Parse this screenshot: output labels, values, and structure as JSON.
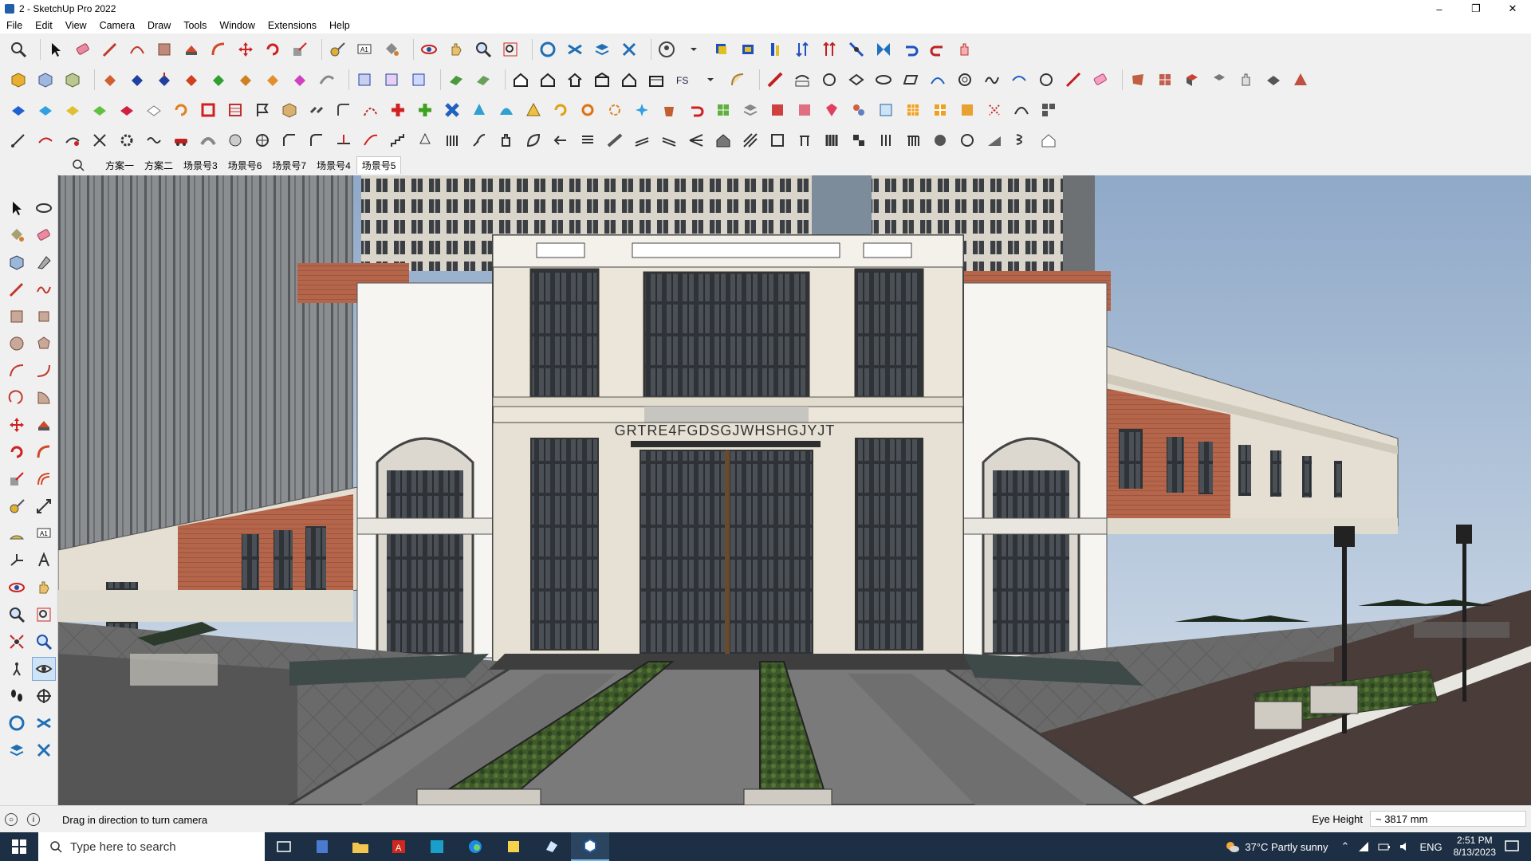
{
  "window": {
    "title": "2 - SketchUp Pro 2022",
    "controls": [
      "–",
      "❐",
      "✕"
    ]
  },
  "menu": [
    "File",
    "Edit",
    "View",
    "Camera",
    "Draw",
    "Tools",
    "Window",
    "Extensions",
    "Help"
  ],
  "scenes": {
    "tabs": [
      "方案一",
      "方案二",
      "场景号3",
      "场景号6",
      "场景号7",
      "场景号4",
      "场景号5"
    ],
    "active_index": 6
  },
  "viewport": {
    "signage": "GRTRE4FGDSGJWHSHGJYJT"
  },
  "status": {
    "hint": "Drag in direction to turn camera",
    "eye_height_label": "Eye Height",
    "eye_height_value": "~ 3817 mm"
  },
  "taskbar": {
    "search_placeholder": "Type here to search",
    "weather": "37°C  Partly sunny",
    "language": "ENG",
    "time": "2:51 PM",
    "date": "8/13/2023"
  },
  "colors": {
    "taskbar_bg": "#1c2f44",
    "sky": "#a9bfd8",
    "brick": "#b5654a",
    "facade": "#e8e2d4",
    "paving": "#5a5a5a",
    "hedge": "#3f5a2a"
  }
}
